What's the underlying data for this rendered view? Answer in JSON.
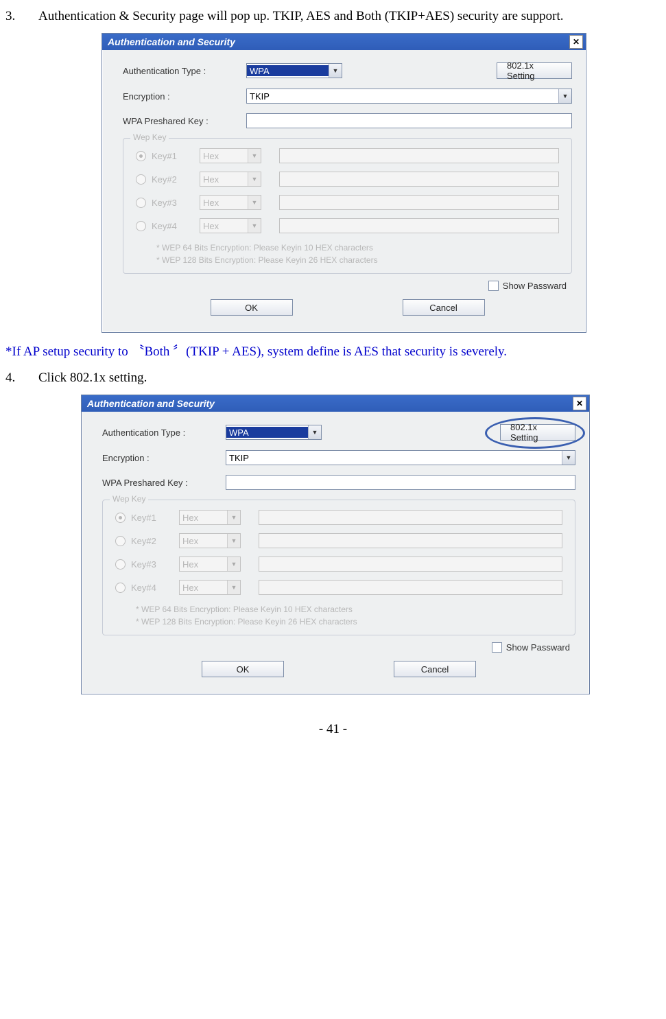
{
  "list3": {
    "num": "3.",
    "text": "Authentication & Security page will pop up. TKIP, AES and Both (TKIP+AES) security are support."
  },
  "note": "*If AP setup security to 〝Both 〞(TKIP + AES), system define is AES that security is severely.",
  "list4": {
    "num": "4.",
    "text": "Click 802.1x setting."
  },
  "footer": "- 41 -",
  "dialog": {
    "title": "Authentication and Security",
    "close": "✕",
    "authTypeLabel": "Authentication Type :",
    "authTypeValue": "WPA",
    "btn8021x": "802.1x Setting",
    "encryptionLabel": "Encryption :",
    "encryptionValue": "TKIP",
    "pskLabel": "WPA Preshared Key :",
    "wepLegend": "Wep Key",
    "keys": [
      {
        "label": "Key#1",
        "fmt": "Hex",
        "checked": true
      },
      {
        "label": "Key#2",
        "fmt": "Hex",
        "checked": false
      },
      {
        "label": "Key#3",
        "fmt": "Hex",
        "checked": false
      },
      {
        "label": "Key#4",
        "fmt": "Hex",
        "checked": false
      }
    ],
    "hint1": "* WEP 64 Bits Encryption:   Please Keyin 10 HEX characters",
    "hint2": "* WEP 128 Bits Encryption:  Please Keyin 26 HEX characters",
    "showPw": "Show Passward",
    "ok": "OK",
    "cancel": "Cancel"
  }
}
